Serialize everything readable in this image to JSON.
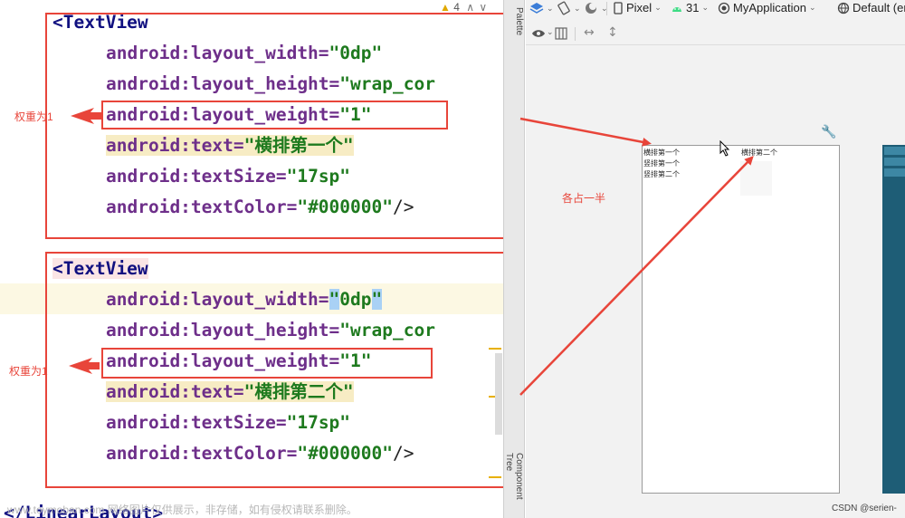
{
  "editor": {
    "block1": {
      "open": "<TextView",
      "width_attr": "android:layout_width=",
      "width_val": "\"0dp\"",
      "height_attr": "android:layout_height=",
      "height_val": "\"wrap_cor",
      "weight_attr": "android:layout_weight=",
      "weight_val": "\"1\"",
      "text_attr": "android:text=",
      "text_val": "\"横排第一个\"",
      "size_attr": "android:textSize=",
      "size_val": "\"17sp\"",
      "color_attr": "android:textColor=",
      "color_val": "\"#000000\"",
      "close": "/>"
    },
    "block2": {
      "open": "<TextView",
      "width_attr": "android:layout_width=",
      "width_val_q1": "\"",
      "width_val": "0dp",
      "width_val_q2": "\"",
      "height_attr": "android:layout_height=",
      "height_val": "\"wrap_cor",
      "weight_attr": "android:layout_weight=",
      "weight_val": "\"1\"",
      "text_attr": "android:text=",
      "text_val": "\"横排第二个\"",
      "size_attr": "android:textSize=",
      "size_val": "\"17sp\"",
      "color_attr": "android:textColor=",
      "color_val": "\"#000000\"",
      "close": "/>"
    },
    "closing_tag": "</LinearLayout>",
    "warning_count": "4",
    "watermark": "www.toymoban.com 网络图片仅供展示，非存储，如有侵权请联系删除。"
  },
  "annotations": {
    "weight_label_1": "权重为1",
    "weight_label_2": "权重为1",
    "half_label": "各占一半"
  },
  "side_tabs": {
    "palette": "Palette",
    "component_tree": "Component Tree"
  },
  "design": {
    "toolbar": {
      "device": "Pixel",
      "api": "31",
      "app": "MyApplication",
      "locale": "Default (en"
    },
    "preview": {
      "row_text_1": "横排第一个",
      "row_text_2": "横排第二个",
      "vertical_1": "竖排第一个",
      "vertical_2": "竖排第二个"
    },
    "watermark": "CSDN @serien-"
  },
  "colors": {
    "annotation_red": "#e8453a",
    "tag_blue": "#101080",
    "attr_purple": "#6e2f8a",
    "value_green": "#1e7a1e",
    "blueprint": "#1e5d76"
  }
}
